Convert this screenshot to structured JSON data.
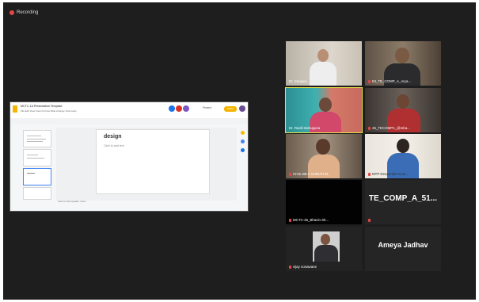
{
  "recording": {
    "label": "Recording"
  },
  "shared_screen": {
    "doc_title": "MCTC-1A Presentation Template",
    "badge": "",
    "menus": "File  Edit  View  Insert  Format  Slide  Arrange  Tools  Help",
    "toolbar": "",
    "present_label": "Present",
    "share_label": "Share",
    "slide_title": "design",
    "slide_subtitle": "Click to add text",
    "notes": "Click to add speaker notes"
  },
  "participants": [
    {
      "name": "Dr. Sanjeev",
      "muted": false,
      "camera": true
    },
    {
      "name": "53_TE_COMP_A_Arya...",
      "muted": true,
      "camera": true
    },
    {
      "name": "Dr. Rashi Bahuguna",
      "muted": false,
      "camera": true,
      "active": true
    },
    {
      "name": "45_TECOMPA_@mba...",
      "muted": true,
      "camera": true
    },
    {
      "name": "CIVIL BE A SHRUTI M...",
      "muted": true,
      "camera": true
    },
    {
      "name": "MTP Deepender Kum...",
      "muted": true,
      "camera": true
    },
    {
      "name": "MCTC-35_Bhavin Sh...",
      "muted": true,
      "camera": false,
      "black": true
    },
    {
      "name": "",
      "muted": true,
      "camera": false,
      "display_name": "TE_COMP_A_51..."
    },
    {
      "name": "vijay sonawane",
      "muted": true,
      "camera": true
    },
    {
      "name": "",
      "muted": false,
      "camera": false,
      "display_name": "Ameya Jadhav"
    }
  ],
  "colors": {
    "background": "#1e1e1e",
    "active_border": "#e8e04a",
    "muted_icon": "#e54747",
    "slides_brand": "#f4b400"
  }
}
